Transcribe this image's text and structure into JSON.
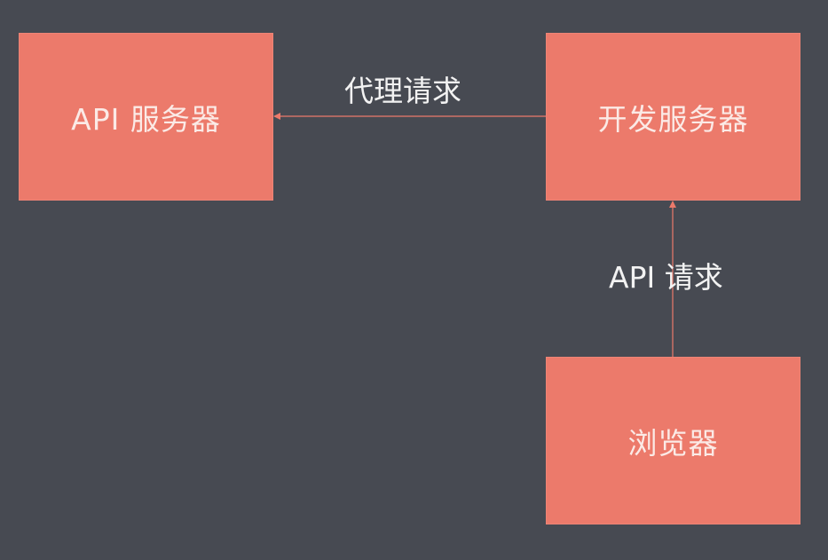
{
  "nodes": {
    "api_server": "API 服务器",
    "dev_server": "开发服务器",
    "browser": "浏览器"
  },
  "edges": {
    "proxy_request": "代理请求",
    "api_request": "API 请求"
  },
  "colors": {
    "background": "#474a52",
    "node_fill": "#ec7a6b",
    "arrow": "#ec7a6b",
    "node_text": "#fbeae6",
    "label_text": "#f2f2f2"
  }
}
